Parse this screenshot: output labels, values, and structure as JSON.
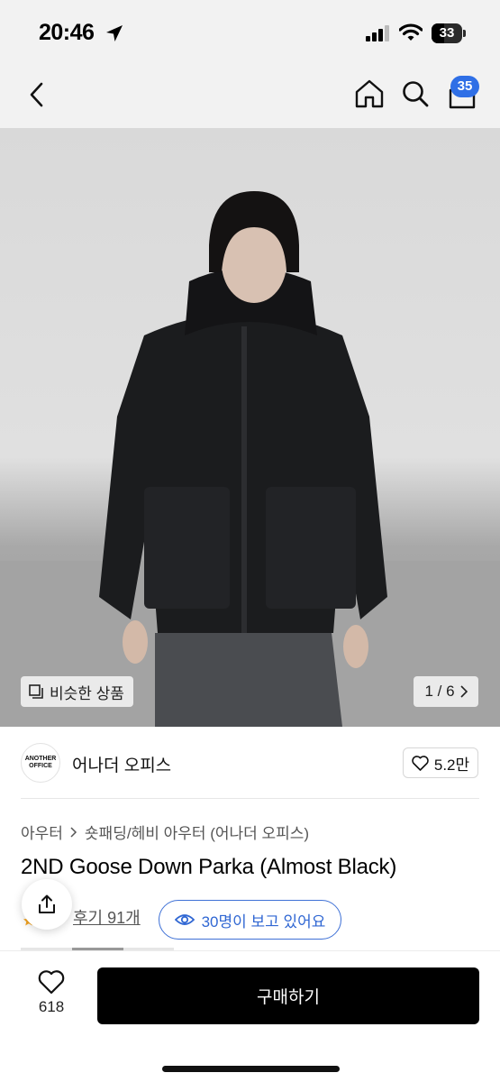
{
  "status_bar": {
    "time": "20:46",
    "battery": "33",
    "icons": [
      "location-arrow-icon",
      "cellular-signal-icon",
      "wifi-icon",
      "battery-icon"
    ]
  },
  "nav": {
    "icons": [
      "back-chevron-icon",
      "home-icon",
      "search-icon",
      "shopping-bag-icon"
    ],
    "cart_count": "35",
    "badge_color": "#2f6fe6"
  },
  "gallery": {
    "similar_label": "비슷한 상품",
    "page_indicator": "1 / 6",
    "image_description_icon": "product-photo"
  },
  "brand": {
    "logo_text_line1": "ANOTHER",
    "logo_text_line2": "OFFICE",
    "name": "어나더 오피스",
    "likes": "5.2만"
  },
  "product": {
    "breadcrumb": [
      "아우터",
      "숏패딩/헤비 아우터 (어나더 오피스)"
    ],
    "title": "2ND Goose Down Parka (Almost Black)",
    "review_label": "후기 91개",
    "viewers_label": "30명이 보고 있어요",
    "accent_color": "#3f71d6"
  },
  "bottom_bar": {
    "wish_count": "618",
    "buy_label": "구매하기"
  }
}
